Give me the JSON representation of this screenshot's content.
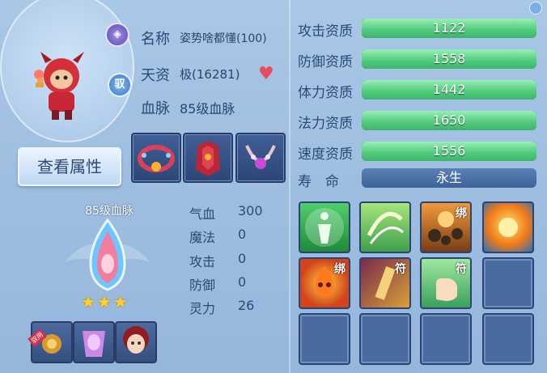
{
  "pet": {
    "name_label": "名称",
    "name_value": "姿势啥都懂(100)",
    "talent_label": "天资",
    "talent_value": "极(16281)",
    "bloodline_label": "血脉",
    "bloodline_value": "85级血脉",
    "badge_top_icon": "shield-emblem-icon",
    "badge_side_text": "驭"
  },
  "view_button_label": "查看属性",
  "equipment": [
    {
      "name": "bracelet-equip-icon"
    },
    {
      "name": "armor-equip-icon"
    },
    {
      "name": "necklace-equip-icon"
    }
  ],
  "bloodline_panel": {
    "title": "85级血脉",
    "stars": "★★★",
    "star_count": 3,
    "tag_text": "驭用"
  },
  "attributes": [
    {
      "label": "气血",
      "value": "300"
    },
    {
      "label": "魔法",
      "value": "0"
    },
    {
      "label": "攻击",
      "value": "0"
    },
    {
      "label": "防御",
      "value": "0"
    },
    {
      "label": "灵力",
      "value": "26"
    }
  ],
  "aptitudes": [
    {
      "label": "攻击资质",
      "value": "1122",
      "fill_fraction": 1.0
    },
    {
      "label": "防御资质",
      "value": "1558",
      "fill_fraction": 1.0
    },
    {
      "label": "体力资质",
      "value": "1442",
      "fill_fraction": 1.0
    },
    {
      "label": "法力资质",
      "value": "1650",
      "fill_fraction": 1.0
    },
    {
      "label": "速度资质",
      "value": "1556",
      "fill_fraction": 1.0
    }
  ],
  "lifespan": {
    "label": "寿　命",
    "value": "永生"
  },
  "skills": [
    {
      "name": "figure-skill-icon",
      "tag": ""
    },
    {
      "name": "swirl-skill-icon",
      "tag": ""
    },
    {
      "name": "rocks-skill-icon",
      "tag": "绑"
    },
    {
      "name": "fireball-skill-icon",
      "tag": ""
    },
    {
      "name": "fire-face-skill-icon",
      "tag": "绑"
    },
    {
      "name": "talisman-skill-icon",
      "tag": "符"
    },
    {
      "name": "hand-skill-icon",
      "tag": "符"
    }
  ],
  "colors": {
    "accent_green": "#54cc7f",
    "panel_blue": "#3a5f91",
    "text_dark": "#2a4a78"
  }
}
